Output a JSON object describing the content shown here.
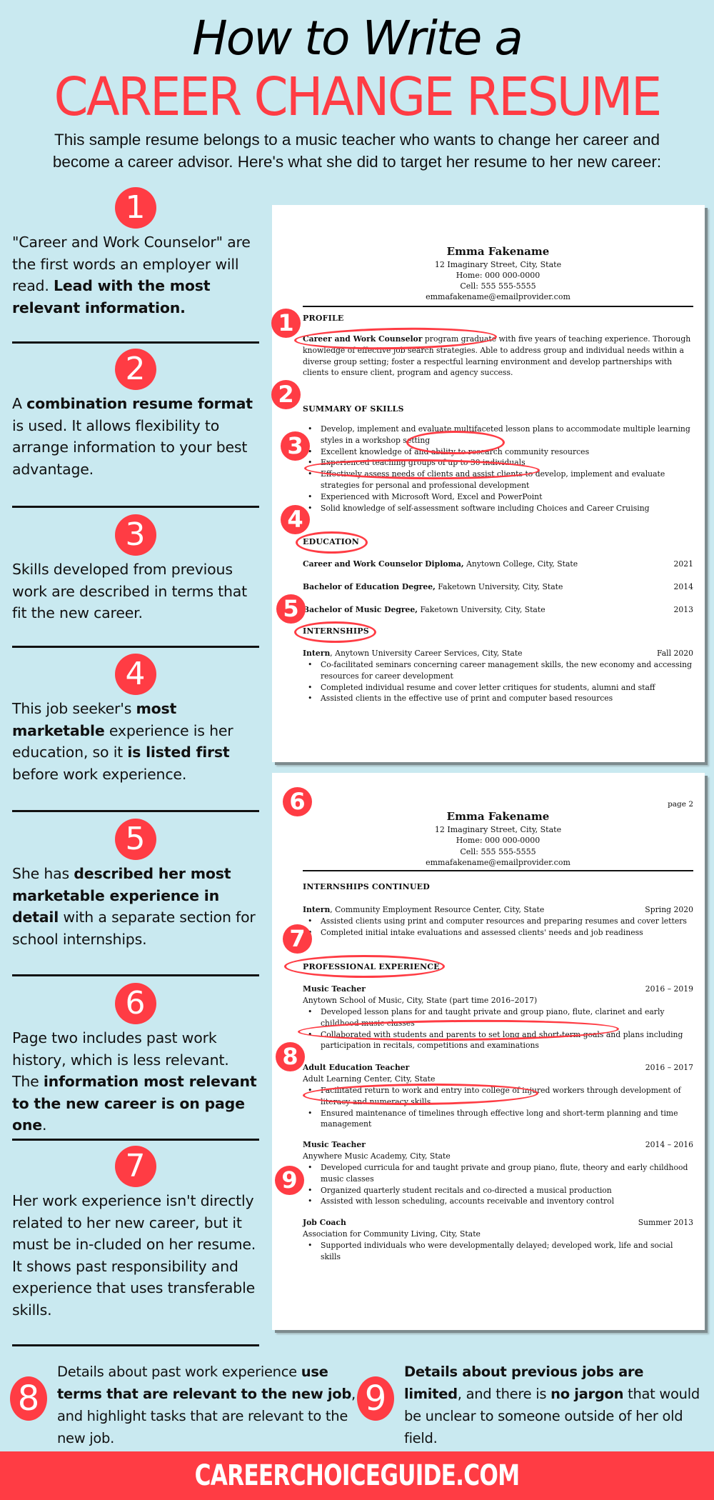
{
  "header": {
    "title_line1": "How to Write a",
    "title_line2": "CAREER CHANGE RESUME",
    "subtitle_line1": "This sample resume belongs to a music teacher who wants to change her career and",
    "subtitle_line2": "become a career advisor.  Here's what she did to target her resume to her new career:"
  },
  "colors": {
    "accent": "#ff3c44",
    "background": "#c9e9f0"
  },
  "tips": [
    {
      "number": "1",
      "parts": [
        {
          "t": "\"Career and Work Counselor\" are the first words an employer will read. ",
          "b": false
        },
        {
          "t": "Lead with the most relevant information.",
          "b": true
        }
      ]
    },
    {
      "number": "2",
      "parts": [
        {
          "t": "A ",
          "b": false
        },
        {
          "t": "combination resume format",
          "b": true
        },
        {
          "t": " is used. It allows flexibility to arrange information to your best advantage.",
          "b": false
        }
      ]
    },
    {
      "number": "3",
      "parts": [
        {
          "t": "Skills developed from previous work are described in terms that fit the new career.",
          "b": false
        }
      ]
    },
    {
      "number": "4",
      "parts": [
        {
          "t": "This job seeker's ",
          "b": false
        },
        {
          "t": "most marketable",
          "b": true
        },
        {
          "t": " experience is her education, so it ",
          "b": false
        },
        {
          "t": "is listed first",
          "b": true
        },
        {
          "t": " before work experience.",
          "b": false
        }
      ]
    },
    {
      "number": "5",
      "parts": [
        {
          "t": "She has ",
          "b": false
        },
        {
          "t": "described her most marketable experience in detail",
          "b": true
        },
        {
          "t": " with a separate section for school internships.",
          "b": false
        }
      ]
    },
    {
      "number": "6",
      "parts": [
        {
          "t": "Page two includes past work history, which is less relevant. The ",
          "b": false
        },
        {
          "t": "information most relevant to the new career is on page one",
          "b": true
        },
        {
          "t": ".",
          "b": false
        }
      ]
    },
    {
      "number": "7",
      "parts": [
        {
          "t": "Her work experience isn't directly related to her new career, but it must be in-cluded on her resume. It shows past responsibility and experience that uses transferable skills.",
          "b": false
        }
      ]
    }
  ],
  "bottom_tips": [
    {
      "number": "8",
      "parts": [
        {
          "t": "Details about past work experience ",
          "b": false
        },
        {
          "t": "use terms that are relevant to the new job",
          "b": true
        },
        {
          "t": ", and highlight tasks that are relevant to the new job.",
          "b": false
        }
      ]
    },
    {
      "number": "9",
      "parts": [
        {
          "t": "Details about previous jobs are limited",
          "b": true
        },
        {
          "t": ", and there is ",
          "b": false
        },
        {
          "t": "no jargon",
          "b": true
        },
        {
          "t": " that would be unclear to someone outside of her old field.",
          "b": false
        }
      ]
    }
  ],
  "resume": {
    "name": "Emma Fakename",
    "address": "12 Imaginary Street, City, State",
    "home": "Home: 000 000-0000",
    "cell": "Cell: 555 555-5555",
    "email": "emmafakename@emailprovider.com",
    "page1": {
      "profile_heading": "PROFILE",
      "profile_bold1": "Career and ",
      "profile_bold2": "Work Counselor",
      "profile_text_line1": " program graduate with five years of teaching experience.",
      "profile_text_rest": "Thorough knowledge of effective job search strategies. Able to address group and individual needs within a diverse group setting; foster a respectful learning environment and develop partnerships with clients to ensure client, program and agency success.",
      "skills_heading": "SUMMARY OF SKILLS",
      "skills": [
        "Develop, implement and evaluate multifaceted lesson plans to accommodate multiple learning styles in a workshop setting",
        "Excellent knowledge of and ability to research community resources",
        "Experienced teaching groups of up to 30 individuals",
        "Effectively assess needs of clients and assist clients to develop, implement and evaluate strategies for personal and professional development",
        "Experienced with Microsoft Word, Excel and PowerPoint",
        "Solid knowledge of self-assessment software including Choices and Career Cruising"
      ],
      "education_heading": "EDUCATION",
      "education": [
        {
          "bold": "Career and Work Counselor Diploma,",
          "rest": " Anytown College, City, State",
          "year": "2021"
        },
        {
          "bold": "Bachelor of Education Degree,",
          "rest": " Faketown University, City, State",
          "year": "2014"
        },
        {
          "bold": "Bachelor of Music Degree,",
          "rest": " Faketown University, City, State",
          "year": "2013"
        }
      ],
      "internships_heading": "INTERNSHIPS",
      "internship": {
        "bold": "Intern",
        "rest": ", Anytown University Career Services, City, State",
        "date": "Fall 2020",
        "bullets": [
          "Co-facilitated seminars concerning career management skills, the new economy and accessing resources for career development",
          "Completed individual resume and cover letter critiques for students, alumni and staff",
          "Assisted clients in the effective use of print and computer based resources"
        ]
      }
    },
    "page2": {
      "page_label": "page 2",
      "internships_cont_heading": "INTERNSHIPS CONTINUED",
      "internship": {
        "bold": "Intern",
        "rest": ", Community Employment Resource Center, City, State",
        "date": "Spring 2020",
        "bullets": [
          "Assisted clients using print and computer resources and preparing resumes and cover letters",
          "Completed initial intake evaluations and assessed clients' needs and job readiness"
        ]
      },
      "experience_heading": "PROFESSIONAL EXPERIENCE",
      "jobs": [
        {
          "title": "Music Teacher",
          "dates": "2016 – 2019",
          "org": "Anytown School of Music, City, State (part time 2016–2017)",
          "bullets": [
            "Developed lesson plans for and taught private and group piano, flute, clarinet and early childhood music classes",
            "Collaborated with students and parents to set long and short-term goals and plans including participation in recitals, competitions and examinations"
          ]
        },
        {
          "title": "Adult Education Teacher",
          "dates": "2016 – 2017",
          "org": "Adult Learning Center, City, State",
          "bullets": [
            "Facilitated return to work and entry into college of injured workers through development of literacy and numeracy skills",
            "Ensured maintenance of timelines through effective long and short-term planning and time management"
          ]
        },
        {
          "title": "Music Teacher",
          "dates": "2014 – 2016",
          "org": "Anywhere Music Academy, City, State",
          "bullets": [
            "Developed curricula for and taught private and group piano, flute, theory and early childhood music classes",
            "Organized quarterly student recitals and co-directed a musical production",
            "Assisted with lesson scheduling, accounts receivable and inventory control"
          ]
        },
        {
          "title": "Job Coach",
          "dates": "Summer 2013",
          "org": "Association for Community Living, City, State",
          "bullets": [
            "Supported individuals who were developmentally delayed; developed work, life and social skills"
          ]
        }
      ]
    },
    "markers": [
      "1",
      "2",
      "3",
      "4",
      "5",
      "6",
      "7",
      "8",
      "9"
    ]
  },
  "footer": {
    "site": "CAREERCHOICEGUIDE.COM"
  }
}
